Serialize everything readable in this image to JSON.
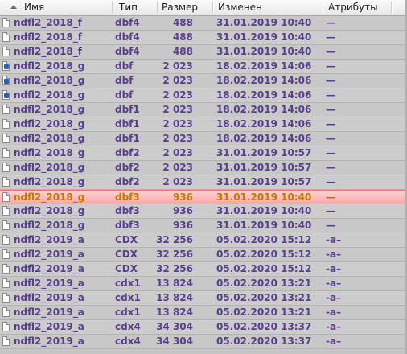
{
  "columns": {
    "name": "Имя",
    "type": "Тип",
    "size": "Размер",
    "modified": "Изменен",
    "attributes": "Атрибуты"
  },
  "colors": {
    "row_text": "#5a3f8c",
    "selected_text": "#c07a00",
    "selected_bg": "#f6a8a8",
    "panel_bg": "#c6c6c6"
  },
  "selected_index": 12,
  "files": [
    {
      "name": "ndfl2_2018_f",
      "type": "dbf4",
      "size": "488",
      "modified": "31.01.2019 10:40",
      "attr": "—",
      "icon": "file-icon"
    },
    {
      "name": "ndfl2_2018_f",
      "type": "dbf4",
      "size": "488",
      "modified": "31.01.2019 10:40",
      "attr": "—",
      "icon": "file-icon"
    },
    {
      "name": "ndfl2_2018_f",
      "type": "dbf4",
      "size": "488",
      "modified": "31.01.2019 10:40",
      "attr": "—",
      "icon": "file-icon"
    },
    {
      "name": "ndfl2_2018_g",
      "type": "dbf",
      "size": "2 023",
      "modified": "18.02.2019 14:06",
      "attr": "—",
      "icon": "dbf-file-icon"
    },
    {
      "name": "ndfl2_2018_g",
      "type": "dbf",
      "size": "2 023",
      "modified": "18.02.2019 14:06",
      "attr": "—",
      "icon": "dbf-file-icon"
    },
    {
      "name": "ndfl2_2018_g",
      "type": "dbf",
      "size": "2 023",
      "modified": "18.02.2019 14:06",
      "attr": "—",
      "icon": "dbf-file-icon"
    },
    {
      "name": "ndfl2_2018_g",
      "type": "dbf1",
      "size": "2 023",
      "modified": "18.02.2019 14:06",
      "attr": "—",
      "icon": "file-icon"
    },
    {
      "name": "ndfl2_2018_g",
      "type": "dbf1",
      "size": "2 023",
      "modified": "18.02.2019 14:06",
      "attr": "—",
      "icon": "file-icon"
    },
    {
      "name": "ndfl2_2018_g",
      "type": "dbf1",
      "size": "2 023",
      "modified": "18.02.2019 14:06",
      "attr": "—",
      "icon": "file-icon"
    },
    {
      "name": "ndfl2_2018_g",
      "type": "dbf2",
      "size": "2 023",
      "modified": "31.01.2019 10:57",
      "attr": "—",
      "icon": "file-icon"
    },
    {
      "name": "ndfl2_2018_g",
      "type": "dbf2",
      "size": "2 023",
      "modified": "31.01.2019 10:57",
      "attr": "—",
      "icon": "file-icon"
    },
    {
      "name": "ndfl2_2018_g",
      "type": "dbf2",
      "size": "2 023",
      "modified": "31.01.2019 10:57",
      "attr": "—",
      "icon": "file-icon"
    },
    {
      "name": "ndfl2_2018_g",
      "type": "dbf3",
      "size": "936",
      "modified": "31.01.2019 10:40",
      "attr": "—",
      "icon": "file-icon"
    },
    {
      "name": "ndfl2_2018_g",
      "type": "dbf3",
      "size": "936",
      "modified": "31.01.2019 10:40",
      "attr": "—",
      "icon": "file-icon"
    },
    {
      "name": "ndfl2_2018_g",
      "type": "dbf3",
      "size": "936",
      "modified": "31.01.2019 10:40",
      "attr": "—",
      "icon": "file-icon"
    },
    {
      "name": "ndfl2_2019_a",
      "type": "CDX",
      "size": "32 256",
      "modified": "05.02.2020 15:12",
      "attr": "-a–",
      "icon": "file-icon"
    },
    {
      "name": "ndfl2_2019_a",
      "type": "CDX",
      "size": "32 256",
      "modified": "05.02.2020 15:12",
      "attr": "-a–",
      "icon": "file-icon"
    },
    {
      "name": "ndfl2_2019_a",
      "type": "CDX",
      "size": "32 256",
      "modified": "05.02.2020 15:12",
      "attr": "-a–",
      "icon": "file-icon"
    },
    {
      "name": "ndfl2_2019_a",
      "type": "cdx1",
      "size": "13 824",
      "modified": "05.02.2020 13:21",
      "attr": "-a–",
      "icon": "file-icon"
    },
    {
      "name": "ndfl2_2019_a",
      "type": "cdx1",
      "size": "13 824",
      "modified": "05.02.2020 13:21",
      "attr": "-a–",
      "icon": "file-icon"
    },
    {
      "name": "ndfl2_2019_a",
      "type": "cdx1",
      "size": "13 824",
      "modified": "05.02.2020 13:21",
      "attr": "-a–",
      "icon": "file-icon"
    },
    {
      "name": "ndfl2_2019_a",
      "type": "cdx4",
      "size": "34 304",
      "modified": "05.02.2020 13:37",
      "attr": "-a–",
      "icon": "file-icon"
    },
    {
      "name": "ndfl2_2019_a",
      "type": "cdx4",
      "size": "34 304",
      "modified": "05.02.2020 13:37",
      "attr": "-a–",
      "icon": "file-icon"
    }
  ]
}
